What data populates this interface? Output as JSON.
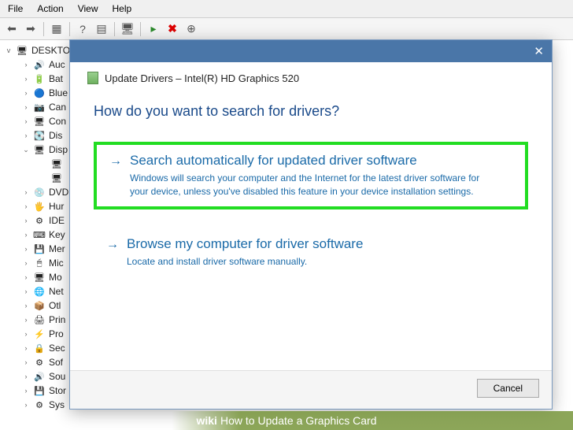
{
  "menu": {
    "file": "File",
    "action": "Action",
    "view": "View",
    "help": "Help"
  },
  "tree": {
    "root": "DESKTO",
    "items": [
      {
        "icon": "🔊",
        "label": "Auc",
        "exp": ">"
      },
      {
        "icon": "🔋",
        "label": "Bat",
        "exp": ">"
      },
      {
        "icon": "🔵",
        "label": "Blue",
        "exp": ">"
      },
      {
        "icon": "📷",
        "label": "Can",
        "exp": ">"
      },
      {
        "icon": "🖥",
        "label": "Con",
        "exp": ">"
      },
      {
        "icon": "💽",
        "label": "Dis",
        "exp": ">"
      },
      {
        "icon": "🖥",
        "label": "Disp",
        "exp": "v"
      },
      {
        "icon": "💿",
        "label": "DVD",
        "exp": ">"
      },
      {
        "icon": "🖐",
        "label": "Hur",
        "exp": ">"
      },
      {
        "icon": "⚙",
        "label": "IDE",
        "exp": ">"
      },
      {
        "icon": "⌨",
        "label": "Key",
        "exp": ">"
      },
      {
        "icon": "💾",
        "label": "Mer",
        "exp": ">"
      },
      {
        "icon": "🖱",
        "label": "Mic",
        "exp": ">"
      },
      {
        "icon": "🖥",
        "label": "Mo",
        "exp": ">"
      },
      {
        "icon": "🌐",
        "label": "Net",
        "exp": ">"
      },
      {
        "icon": "📦",
        "label": "Otl",
        "exp": ">"
      },
      {
        "icon": "🖨",
        "label": "Prin",
        "exp": ">"
      },
      {
        "icon": "⚡",
        "label": "Pro",
        "exp": ">"
      },
      {
        "icon": "🔒",
        "label": "Sec",
        "exp": ">"
      },
      {
        "icon": "⚙",
        "label": "Sof",
        "exp": ">"
      },
      {
        "icon": "🔊",
        "label": "Sou",
        "exp": ">"
      },
      {
        "icon": "💾",
        "label": "Stor",
        "exp": ">"
      },
      {
        "icon": "⚙",
        "label": "Sys",
        "exp": ">"
      }
    ],
    "display_children": [
      "",
      ""
    ]
  },
  "dialog": {
    "title": "Update Drivers – Intel(R) HD Graphics 520",
    "heading": "How do you want to search for drivers?",
    "option1": {
      "title": "Search automatically for updated driver software",
      "desc": "Windows will search your computer and the Internet for the latest driver software for your device, unless you've disabled this feature in your device installation settings."
    },
    "option2": {
      "title": "Browse my computer for driver software",
      "desc": "Locate and install driver software manually."
    },
    "cancel": "Cancel"
  },
  "watermark": {
    "brand": "wiki",
    "how": "How to ",
    "title": "Update a Graphics Card"
  }
}
